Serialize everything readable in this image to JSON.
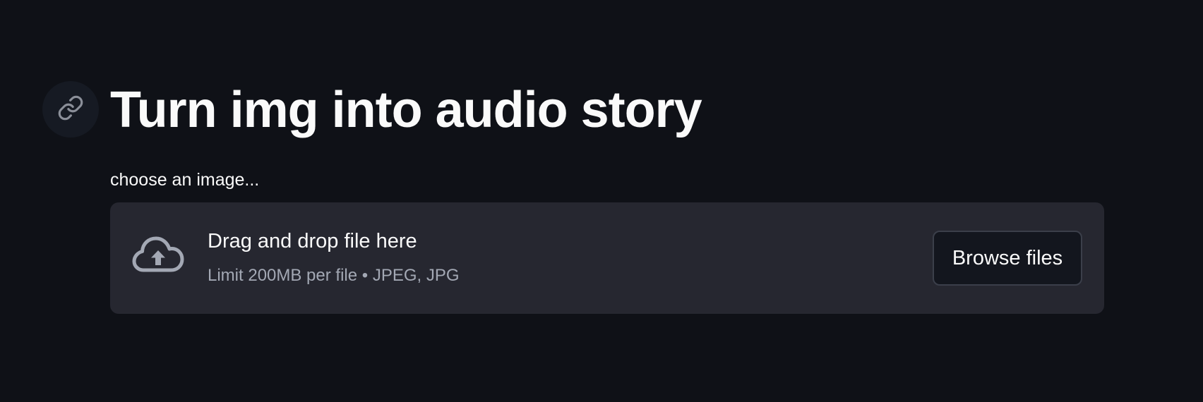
{
  "header": {
    "anchor_icon": "link-icon",
    "title": "Turn img into audio story"
  },
  "uploader": {
    "label": "choose an image...",
    "icon": "cloud-upload-icon",
    "drag_text": "Drag and drop file here",
    "limit_text": "Limit 200MB per file • JPEG, JPG",
    "browse_label": "Browse files"
  },
  "colors": {
    "background": "#0f1117",
    "dropzone": "#262730",
    "text": "#fafafa",
    "muted_text": "#a3a8b4",
    "icon": "#a3a8b4"
  }
}
